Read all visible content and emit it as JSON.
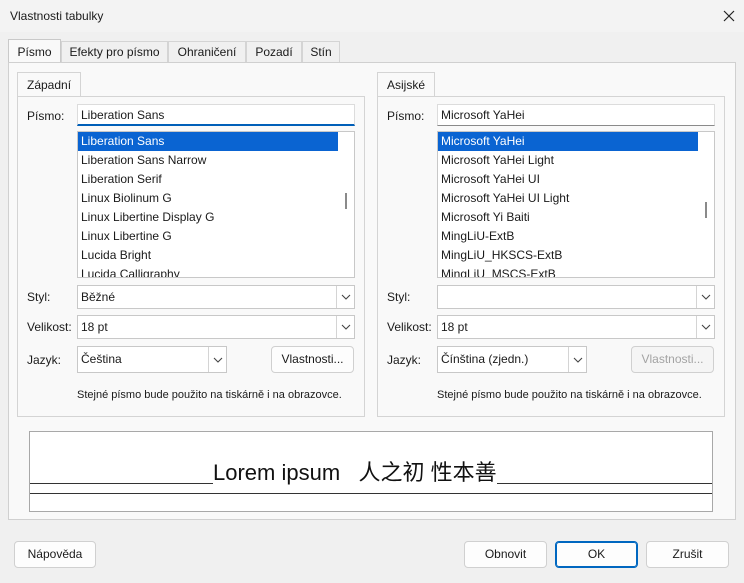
{
  "window": {
    "title": "Vlastnosti tabulky"
  },
  "tabs": [
    "Písmo",
    "Efekty pro písmo",
    "Ohraničení",
    "Pozadí",
    "Stín"
  ],
  "western": {
    "group_label": "Západní",
    "font_label": "Písmo:",
    "font_value": "Liberation Sans",
    "font_list": [
      "Liberation Sans",
      "Liberation Sans Narrow",
      "Liberation Serif",
      "Linux Biolinum G",
      "Linux Libertine Display G",
      "Linux Libertine G",
      "Lucida Bright",
      "Lucida Calligraphy"
    ],
    "style_label": "Styl:",
    "style_value": "Běžné",
    "size_label": "Velikost:",
    "size_value": "18 pt",
    "language_label": "Jazyk:",
    "language_value": "Čeština",
    "features_button": "Vlastnosti...",
    "note": "Stejné písmo bude použito na tiskárně i na obrazovce."
  },
  "asian": {
    "group_label": "Asijské",
    "font_label": "Písmo:",
    "font_value": "Microsoft YaHei",
    "font_list": [
      "Microsoft YaHei",
      "Microsoft YaHei Light",
      "Microsoft YaHei UI",
      "Microsoft YaHei UI Light",
      "Microsoft Yi Baiti",
      "MingLiU-ExtB",
      "MingLiU_HKSCS-ExtB",
      "MingLiU_MSCS-ExtB"
    ],
    "style_label": "Styl:",
    "style_value": "",
    "size_label": "Velikost:",
    "size_value": "18 pt",
    "language_label": "Jazyk:",
    "language_value": "Čínština (zjedn.)",
    "features_button": "Vlastnosti...",
    "note": "Stejné písmo bude použito na tiskárně i na obrazovce."
  },
  "preview": {
    "text": "Lorem ipsum   人之初 性本善"
  },
  "buttons": {
    "help": "Nápověda",
    "reset": "Obnovit",
    "ok": "OK",
    "cancel": "Zrušit"
  },
  "colors": {
    "selection": "#0a64d2",
    "accent": "#0067c0"
  }
}
